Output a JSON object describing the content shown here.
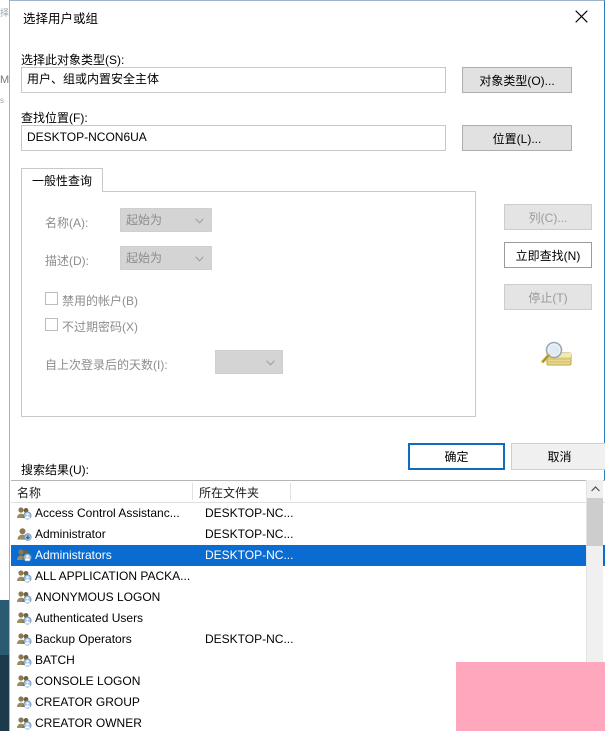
{
  "background_window": {
    "fragments": [
      "择",
      "M",
      "s"
    ]
  },
  "dialog": {
    "title": "选择用户或组",
    "close_icon": "close-icon",
    "object_type": {
      "label": "选择此对象类型(S):",
      "value": "用户、组或内置安全主体",
      "button": "对象类型(O)..."
    },
    "location": {
      "label": "查找位置(F):",
      "value": "DESKTOP-NCON6UA",
      "button": "位置(L)..."
    },
    "tab": {
      "label": "一般性查询"
    },
    "query": {
      "name_label": "名称(A):",
      "name_value": "起始为",
      "desc_label": "描述(D):",
      "desc_value": "起始为",
      "disabled_accounts": "禁用的帐户(B)",
      "non_expiring_password": "不过期密码(X)",
      "days_since_logon_label": "自上次登录后的天数(I):",
      "days_since_logon_value": ""
    },
    "side_buttons": {
      "columns": "列(C)...",
      "find_now": "立即查找(N)",
      "stop": "停止(T)",
      "icon": "magnifier-folder-icon"
    },
    "footer": {
      "ok": "确定",
      "cancel": "取消"
    },
    "results": {
      "label": "搜索结果(U):",
      "columns": [
        "名称",
        "所在文件夹"
      ],
      "rows": [
        {
          "name": "Access Control Assistanc...",
          "folder": "DESKTOP-NC...",
          "selected": false,
          "icon": "group-icon"
        },
        {
          "name": "Administrator",
          "folder": "DESKTOP-NC...",
          "selected": false,
          "icon": "user-icon"
        },
        {
          "name": "Administrators",
          "folder": "DESKTOP-NC...",
          "selected": true,
          "icon": "group-icon"
        },
        {
          "name": "ALL APPLICATION PACKA...",
          "folder": "",
          "selected": false,
          "icon": "group-icon"
        },
        {
          "name": "ANONYMOUS LOGON",
          "folder": "",
          "selected": false,
          "icon": "group-icon"
        },
        {
          "name": "Authenticated Users",
          "folder": "",
          "selected": false,
          "icon": "group-icon"
        },
        {
          "name": "Backup Operators",
          "folder": "DESKTOP-NC...",
          "selected": false,
          "icon": "group-icon"
        },
        {
          "name": "BATCH",
          "folder": "",
          "selected": false,
          "icon": "group-icon"
        },
        {
          "name": "CONSOLE LOGON",
          "folder": "",
          "selected": false,
          "icon": "group-icon"
        },
        {
          "name": "CREATOR GROUP",
          "folder": "",
          "selected": false,
          "icon": "group-icon"
        },
        {
          "name": "CREATOR OWNER",
          "folder": "",
          "selected": false,
          "icon": "group-icon"
        }
      ],
      "scrollbar": {
        "up_arrow_icon": "scroll-up-icon"
      }
    }
  },
  "overlay": {
    "color": "#ffa8bd"
  },
  "colors": {
    "selection": "#0a6cd1",
    "default_button_border": "#0f6cbd",
    "disabled_text": "#9a9a9a"
  }
}
